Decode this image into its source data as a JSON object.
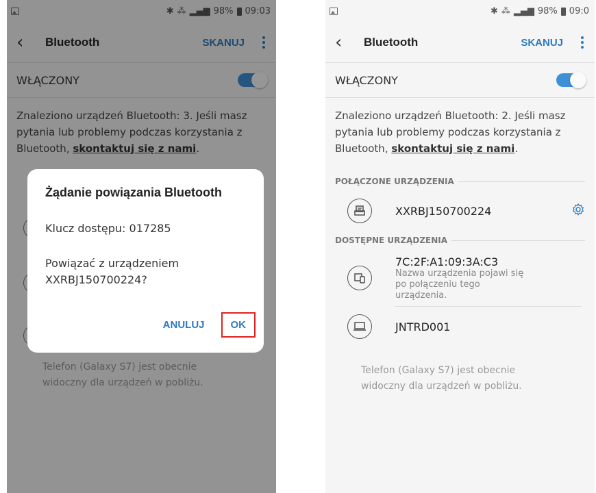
{
  "left": {
    "status": {
      "battery": "98%",
      "time": "09:03"
    },
    "appbar": {
      "title": "Bluetooth",
      "scan_label": "SKANUJ"
    },
    "toggle": {
      "label": "WŁĄCZONY",
      "state": "on"
    },
    "info": {
      "text": "Znaleziono urządzeń Bluetooth: 3. Jeśli masz pytania lub problemy podczas korzystania z Bluetooth, ",
      "link": "skontaktuj się z nami",
      "after": "."
    },
    "footer": "Telefon (Galaxy S7) jest obecnie widoczny dla urządzeń w pobliżu.",
    "dialog": {
      "title": "Żądanie powiązania Bluetooth",
      "key": "Klucz dostępu: 017285",
      "message": "Powiązać z urządzeniem XXRBJ150700224?",
      "cancel_label": "ANULUJ",
      "ok_label": "OK"
    }
  },
  "right": {
    "status": {
      "battery": "98%",
      "time": "09:0"
    },
    "appbar": {
      "title": "Bluetooth",
      "scan_label": "SKANUJ"
    },
    "toggle": {
      "label": "WŁĄCZONY",
      "state": "on"
    },
    "info": {
      "text": "Znaleziono urządzeń Bluetooth: 2. Jeśli masz pytania lub problemy podczas korzystania z Bluetooth, ",
      "link": "skontaktuj się z nami",
      "after": "."
    },
    "paired_header": "POŁĄCZONE URZĄDZENIA",
    "paired": [
      {
        "name": "XXRBJ150700224",
        "icon": "printer-icon"
      }
    ],
    "available_header": "DOSTĘPNE URZĄDZENIA",
    "available": [
      {
        "name": "7C:2F:A1:09:3A:C3",
        "subtitle": "Nazwa urządzenia pojawi się po połączeniu tego urządzenia.",
        "icon": "devices-icon"
      },
      {
        "name": "JNTRD001",
        "icon": "laptop-icon"
      }
    ],
    "footer": "Telefon (Galaxy S7) jest obecnie widoczny dla urządzeń w pobliżu."
  },
  "colors": {
    "accent": "#2d7bbf",
    "highlight": "#e02020",
    "toggle": "#3d8fd6"
  }
}
